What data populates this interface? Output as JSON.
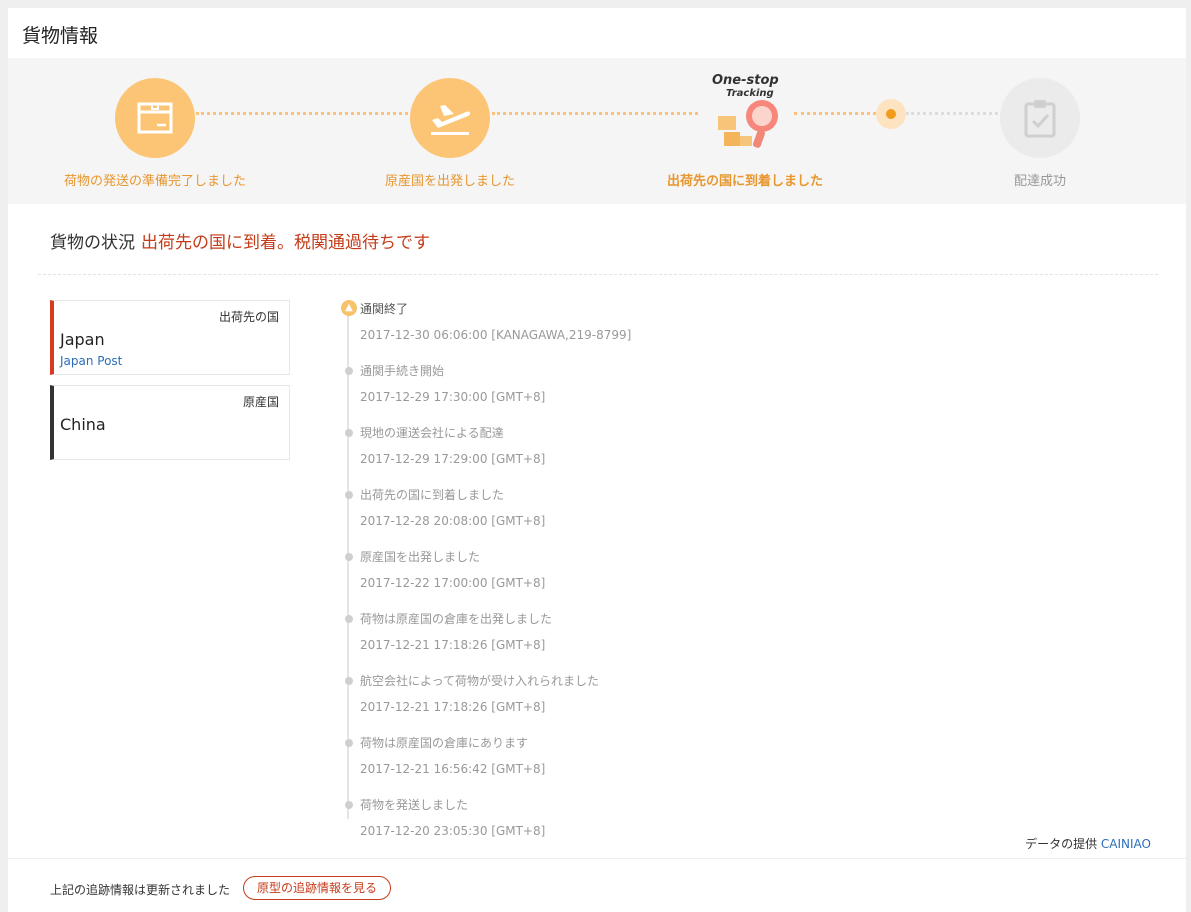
{
  "header": {
    "title": "貨物情報"
  },
  "steps": [
    {
      "label": "荷物の発送の準備完了しました",
      "icon": "package-icon",
      "state": "done"
    },
    {
      "label": "原産国を出発しました",
      "icon": "airplane-takeoff-icon",
      "state": "done"
    },
    {
      "label": "出荷先の国に到着しました",
      "icon": "one-stop-tracking-icon",
      "state": "current"
    },
    {
      "label": "配達成功",
      "icon": "clipboard-check-icon",
      "state": "pending"
    }
  ],
  "onestop": {
    "line1": "One-stop",
    "line2": "Tracking"
  },
  "status": {
    "label": "貨物の状況",
    "value": "出荷先の国に到着。税関通過待ちです"
  },
  "cards": {
    "destination": {
      "role": "出荷先の国",
      "country": "Japan",
      "carrier": "Japan Post"
    },
    "origin": {
      "role": "原産国",
      "country": "China"
    }
  },
  "timeline": [
    {
      "event": "通関終了",
      "time": "2017-12-30 06:06:00 [KANAGAWA,219-8799]"
    },
    {
      "event": "通関手続き開始",
      "time": "2017-12-29 17:30:00 [GMT+8]"
    },
    {
      "event": "現地の運送会社による配達",
      "time": "2017-12-29 17:29:00 [GMT+8]"
    },
    {
      "event": "出荷先の国に到着しました",
      "time": "2017-12-28 20:08:00 [GMT+8]"
    },
    {
      "event": "原産国を出発しました",
      "time": "2017-12-22 17:00:00 [GMT+8]"
    },
    {
      "event": "荷物は原産国の倉庫を出発しました",
      "time": "2017-12-21 17:18:26 [GMT+8]"
    },
    {
      "event": "航空会社によって荷物が受け入れられました",
      "time": "2017-12-21 17:18:26 [GMT+8]"
    },
    {
      "event": "荷物は原産国の倉庫にあります",
      "time": "2017-12-21 16:56:42 [GMT+8]"
    },
    {
      "event": "荷物を発送しました",
      "time": "2017-12-20 23:05:30 [GMT+8]"
    }
  ],
  "credit": {
    "text": "データの提供",
    "provider": "CAINIAO"
  },
  "footer": {
    "note": "上記の追跡情報は更新されました",
    "button": "原型の追跡情報を見る"
  },
  "colors": {
    "accent": "#fbc575",
    "status": "#c43c1a",
    "link": "#2a6fb8"
  }
}
